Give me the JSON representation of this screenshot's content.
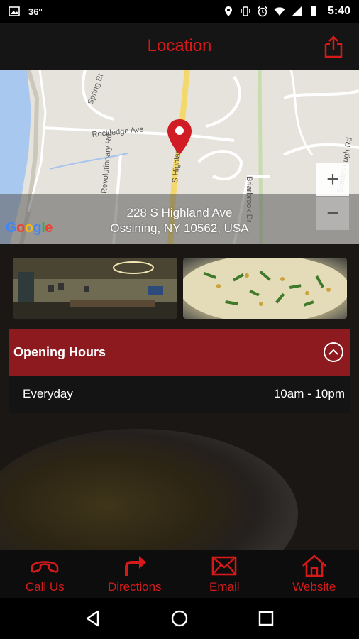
{
  "status_bar": {
    "temperature": "36°",
    "time": "5:40",
    "icons": [
      "image-icon",
      "location-icon",
      "vibrate-icon",
      "alarm-icon",
      "wifi-icon",
      "signal-icon",
      "battery-icon"
    ]
  },
  "app_bar": {
    "title": "Location",
    "share_icon": "share-icon"
  },
  "map": {
    "address_line1": "228 S Highland Ave",
    "address_line2": "Ossining, NY 10562, USA",
    "logo": "Google",
    "zoom_in": "+",
    "zoom_out": "−",
    "street_labels": [
      "Spring St",
      "Rockledge Ave",
      "Revolutionary Rd",
      "S Highland Ave",
      "Briarbrook Dr",
      "Scarborough Rd"
    ]
  },
  "photos": [
    {
      "name": "restaurant-interior-photo"
    },
    {
      "name": "food-dish-photo"
    }
  ],
  "hours": {
    "header": "Opening Hours",
    "rows": [
      {
        "day": "Everyday",
        "time": "10am - 10pm"
      }
    ]
  },
  "actions": [
    {
      "label": "Call Us",
      "icon": "phone-icon"
    },
    {
      "label": "Directions",
      "icon": "directions-arrow-icon"
    },
    {
      "label": "Email",
      "icon": "envelope-icon"
    },
    {
      "label": "Website",
      "icon": "home-icon"
    }
  ],
  "colors": {
    "accent": "#d61a1a",
    "hours_header": "#8c1a1f"
  }
}
